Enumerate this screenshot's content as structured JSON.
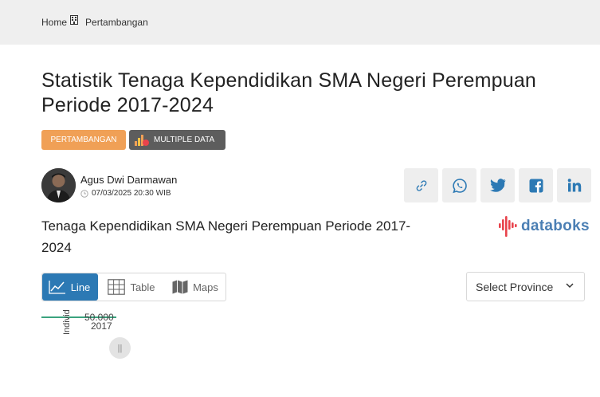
{
  "breadcrumb": {
    "home": "Home",
    "current": "Pertambangan",
    "separator_icon": "building-icon"
  },
  "article": {
    "title": "Statistik Tenaga Kependidikan SMA Negeri Perempuan Periode 2017-2024",
    "category_tag": "PERTAMBANGAN",
    "multiple_data_tag": "MULTIPLE DATA"
  },
  "author": {
    "name": "Agus Dwi Darmawan",
    "date": "07/03/2025 20:30 WIB"
  },
  "share": {
    "icons": [
      "link-icon",
      "whatsapp-icon",
      "twitter-icon",
      "facebook-icon",
      "linkedin-icon"
    ]
  },
  "chart_section": {
    "subtitle": "Tenaga Kependidikan SMA Negeri Perempuan Periode 2017-2024",
    "logo_text": "databoks"
  },
  "view_tabs": {
    "line": "Line",
    "table": "Table",
    "maps": "Maps",
    "active": "line"
  },
  "province_select": {
    "selected": "Select Province"
  },
  "colors": {
    "accent_blue": "#2c79b4",
    "category_orange": "#f0a056",
    "line_green": "#3aa37e",
    "databoks_blue": "#4b7fb4",
    "databoks_red": "#e8434c"
  },
  "chart_data": {
    "type": "line",
    "ylabel": "Individ",
    "yticks": [
      "50.000"
    ],
    "categories": [
      "2017"
    ]
  }
}
